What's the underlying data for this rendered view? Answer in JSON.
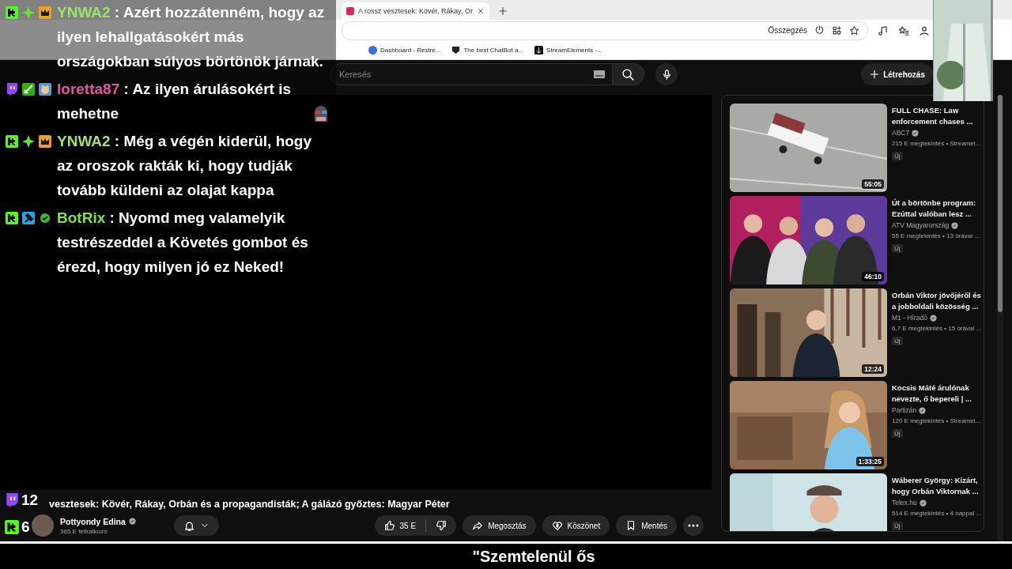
{
  "browser": {
    "tabs": [
      {
        "title": "A rossz vesztesek: Kövér, Rákay, Or",
        "selected": true
      }
    ],
    "summary_label": "Összegzés",
    "bookmarks": [
      {
        "label": "Dashboard - Restre...",
        "kind": "letter-circle"
      },
      {
        "label": "The best ChatBot a...",
        "kind": "shield"
      },
      {
        "label": "StreamElements -...",
        "kind": "anchor"
      }
    ]
  },
  "youtube": {
    "search": {
      "placeholder": "Keresés"
    },
    "create_label": "Létrehozás",
    "video": {
      "title": "vesztesek: Kövér, Rákay, Orbán és a propagandisták; A gálázó győztes: Magyar Péter",
      "channel": "Pottyondy Edina",
      "verified": true,
      "subscribers": "365 E feliratkozó",
      "likes": "35 E",
      "actions": [
        {
          "label": "Megosztás",
          "kind": "share"
        },
        {
          "label": "Köszönet",
          "kind": "thanks"
        },
        {
          "label": "Mentés",
          "kind": "save"
        }
      ]
    },
    "recommended": [
      {
        "title": "FULL CHASE: Law enforcement chases ...",
        "channel": "ABC7",
        "verified": true,
        "stats": "215 E megtekintés • Streamel...",
        "badge": "Új",
        "duration": "55:05"
      },
      {
        "title": "Út a börtönbe program: Ezúttal valóban lesz ...",
        "channel": "ATV Magyarország",
        "verified": true,
        "stats": "55 E megtekintés • 13 órával ...",
        "badge": "Új",
        "duration": "46:10"
      },
      {
        "title": "Orbán Viktor jövőjéről és a jobboldali közösség ...",
        "channel": "M1 - Híradó",
        "verified": true,
        "stats": "6,7 E megtekintés • 15 órával ...",
        "badge": "Új",
        "duration": "12:24"
      },
      {
        "title": "Kocsis Máté árulónak nevezte, ő bepereli | ...",
        "channel": "Partizán",
        "verified": true,
        "stats": "120 E megtekintés • Streamel...",
        "badge": "Új",
        "duration": "1:33:25"
      },
      {
        "title": "Wáberer György: Kizárt, hogy Orbán Viktornak ...",
        "channel": "Telex.hu",
        "verified": true,
        "stats": "514 E megtekintés • 4 nappal ...",
        "badge": "Új"
      }
    ]
  },
  "chat": [
    {
      "badges": [
        {
          "kind": "kick"
        },
        {
          "kind": "diamond"
        },
        {
          "kind": "crown"
        }
      ],
      "user": "YNWA2",
      "color": "#9de36d",
      "text": ": Azért hozzátenném, hogy az ilyen lehallgatásokért más országokban súlyos börtönök járnak.",
      "has_emote": false
    },
    {
      "badges": [
        {
          "kind": "twitch"
        },
        {
          "kind": "sword"
        },
        {
          "kind": "avatar"
        }
      ],
      "user": "loretta87",
      "color": "#e0569e",
      "text": ": Az ilyen árulásokért is mehetne",
      "has_emote": true
    },
    {
      "badges": [
        {
          "kind": "kick"
        },
        {
          "kind": "diamond"
        },
        {
          "kind": "crown"
        }
      ],
      "user": "YNWA2",
      "color": "#9de36d",
      "text": ": Még a végén kiderül, hogy az oroszok rakták ki, hogy tudják tovább küldeni az olajat kappa",
      "has_emote": false
    },
    {
      "badges": [
        {
          "kind": "kick"
        },
        {
          "kind": "hammer"
        },
        {
          "kind": "check"
        }
      ],
      "user": "BotRix",
      "color": "#7fe04c",
      "text": ": Nyomd meg valamelyik testrészeddel a Követés gombot és érezd, hogy milyen jó ez Neked!",
      "has_emote": false
    }
  ],
  "viewer_counts": [
    {
      "kind": "twitch",
      "count": "12"
    },
    {
      "kind": "kick",
      "count": "6"
    }
  ],
  "caption": "\"Szemtelenül ős"
}
